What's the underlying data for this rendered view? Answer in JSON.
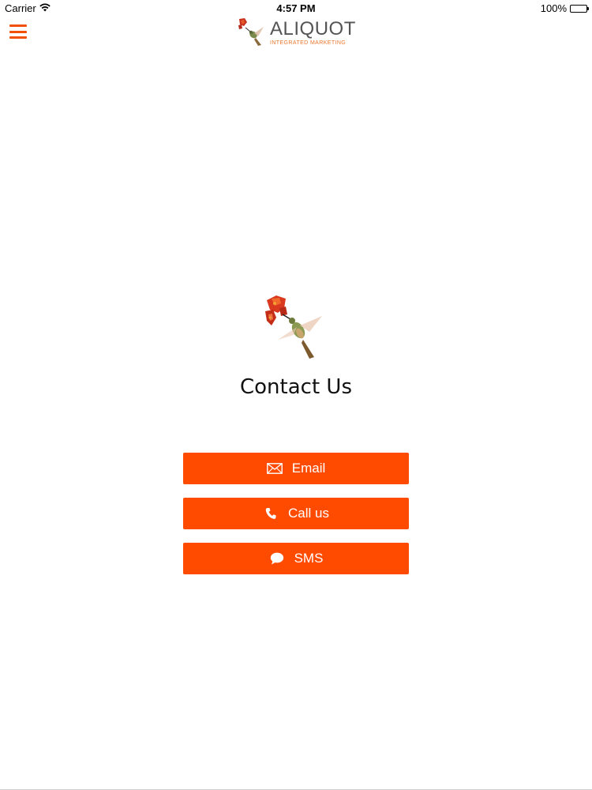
{
  "status_bar": {
    "carrier": "Carrier",
    "time": "4:57 PM",
    "battery": "100%"
  },
  "header": {
    "brand_name": "ALIQUOT",
    "brand_tagline": "INTEGRATED MARKETING",
    "menu_icon": "hamburger-menu-icon"
  },
  "main": {
    "title": "Contact Us",
    "buttons": [
      {
        "label": "Email",
        "icon": "envelope-icon"
      },
      {
        "label": "Call us",
        "icon": "phone-icon"
      },
      {
        "label": "SMS",
        "icon": "chat-bubble-icon"
      }
    ]
  },
  "colors": {
    "accent": "#ff4b00",
    "menu": "#f0500a",
    "brand_text": "#555555",
    "tagline": "#e8772e"
  }
}
